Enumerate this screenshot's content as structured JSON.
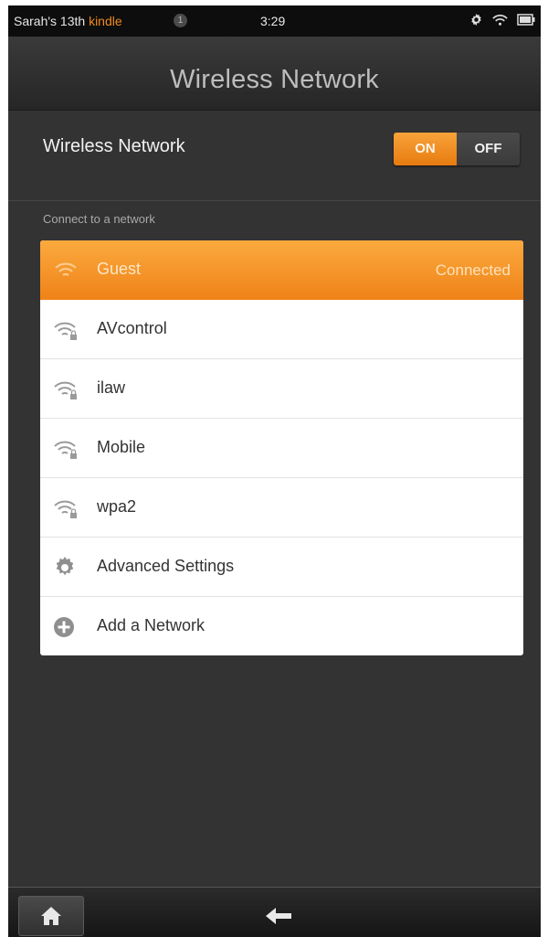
{
  "status_bar": {
    "owner_prefix": "Sarah's 13th ",
    "owner_brand": "kindle",
    "notification_count": "1",
    "time": "3:29",
    "icons": [
      "gear-icon",
      "wifi-icon",
      "battery-icon"
    ]
  },
  "header": {
    "title": "Wireless Network"
  },
  "wireless_toggle": {
    "label": "Wireless Network",
    "on_label": "ON",
    "off_label": "OFF",
    "state": "on"
  },
  "section_label": "Connect to a network",
  "networks": [
    {
      "name": "Guest",
      "status": "Connected",
      "icon": "wifi-icon",
      "secured": false
    },
    {
      "name": "AVcontrol",
      "status": "",
      "icon": "wifi-lock-icon",
      "secured": true
    },
    {
      "name": "ilaw",
      "status": "",
      "icon": "wifi-lock-icon",
      "secured": true
    },
    {
      "name": "Mobile",
      "status": "",
      "icon": "wifi-lock-icon",
      "secured": true
    },
    {
      "name": "wpa2",
      "status": "",
      "icon": "wifi-lock-icon",
      "secured": true
    }
  ],
  "actions": [
    {
      "label": "Advanced Settings",
      "icon": "gear-icon"
    },
    {
      "label": "Add a Network",
      "icon": "plus-circle-icon"
    }
  ],
  "bottom_bar": {
    "home_icon": "home-icon",
    "back_icon": "back-arrow-icon"
  },
  "colors": {
    "accent": "#f08a1c",
    "background": "#333333",
    "list_background": "#ffffff"
  }
}
